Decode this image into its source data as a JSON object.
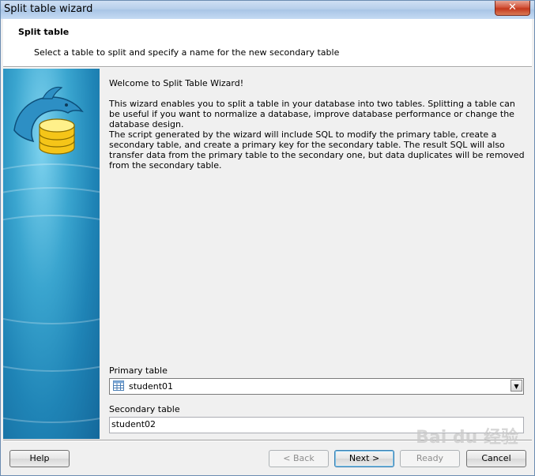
{
  "window": {
    "title": "Split table wizard",
    "close_glyph": "✕"
  },
  "header": {
    "title": "Split table",
    "subtitle": "Select a table to split and specify a name for the new secondary table"
  },
  "content": {
    "welcome": "Welcome to Split Table Wizard!",
    "intro": "This  wizard enables you to split a table in your database into two tables. Splitting a table can be useful if you want to normalize a database, improve database performance or change the database design.",
    "details": "The script generated by the wizard will include SQL to modify the primary table, create a secondary table, and create a primary key for the secondary table. The result SQL will also transfer data from the primary table to the secondary one, but data duplicates will be removed from the secondary table.",
    "primary_label": "Primary table",
    "primary_value": "student01",
    "secondary_label": "Secondary table",
    "secondary_value": "student02"
  },
  "buttons": {
    "help": "Help",
    "back": "< Back",
    "next": "Next >",
    "ready": "Ready",
    "cancel": "Cancel"
  },
  "watermark": "Bai du 经验",
  "icons": {
    "logo": "dolphin-database-icon",
    "combo_item": "table-icon",
    "dropdown": "chevron-down-icon",
    "close": "close-icon"
  }
}
